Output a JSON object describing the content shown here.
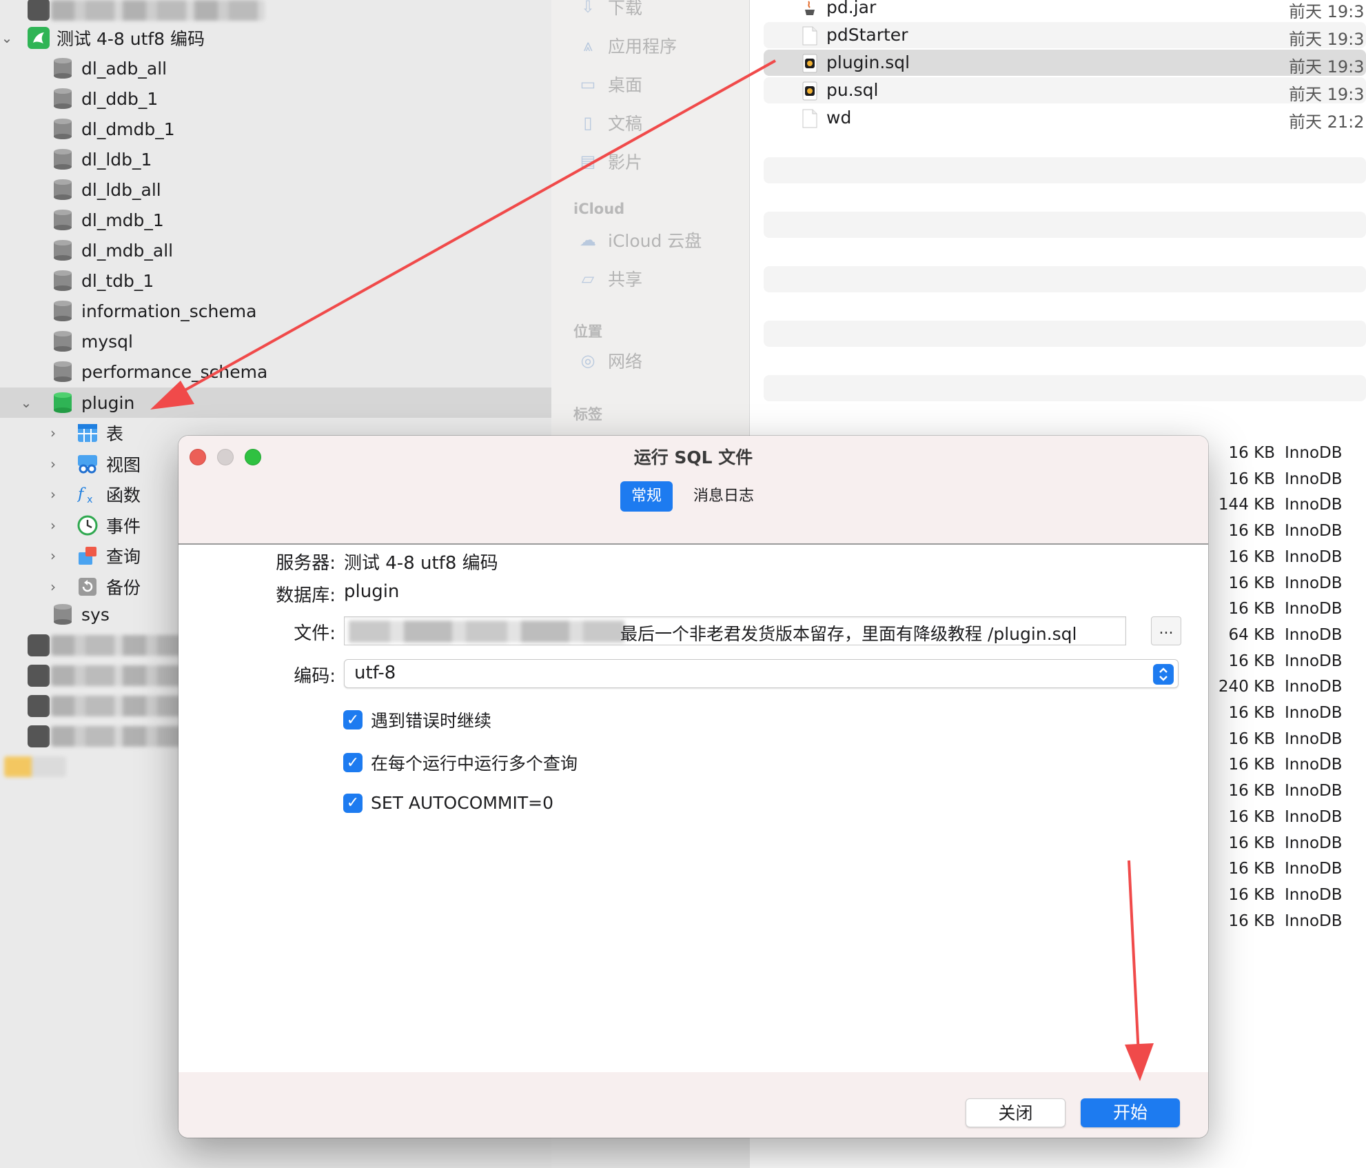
{
  "tree": {
    "top_connection_blurred": "",
    "connection": "测试 4-8 utf8 编码",
    "databases": [
      "dl_adb_all",
      "dl_ddb_1",
      "dl_dmdb_1",
      "dl_ldb_1",
      "dl_ldb_all",
      "dl_mdb_1",
      "dl_mdb_all",
      "dl_tdb_1",
      "information_schema",
      "mysql",
      "performance_schema"
    ],
    "open_database": "plugin",
    "objects": [
      "表",
      "视图",
      "函数",
      "事件",
      "查询",
      "备份"
    ],
    "last_database": "sys"
  },
  "finder_sidebar": {
    "favorites": [
      {
        "label": "下载",
        "icon": "download-icon"
      },
      {
        "label": "应用程序",
        "icon": "applications-icon"
      },
      {
        "label": "桌面",
        "icon": "desktop-icon"
      },
      {
        "label": "文稿",
        "icon": "document-icon"
      },
      {
        "label": "影片",
        "icon": "movies-icon"
      }
    ],
    "icloud_header": "iCloud",
    "icloud": [
      {
        "label": "iCloud 云盘",
        "icon": "cloud-icon"
      },
      {
        "label": "共享",
        "icon": "shared-folder-icon"
      }
    ],
    "locations_header": "位置",
    "locations": [
      {
        "label": "网络",
        "icon": "network-icon"
      }
    ],
    "tags_header": "标签"
  },
  "finder_files": [
    {
      "name": "pd.jar",
      "date": "前天 19:3",
      "icon": "java-jar-icon"
    },
    {
      "name": "pdStarter",
      "date": "前天 19:3",
      "icon": "blank-file-icon"
    },
    {
      "name": "plugin.sql",
      "date": "前天 19:3",
      "icon": "sql-file-icon"
    },
    {
      "name": "pu.sql",
      "date": "前天 19:3",
      "icon": "sql-file-icon"
    },
    {
      "name": "wd",
      "date": "前天 21:2",
      "icon": "blank-file-icon"
    }
  ],
  "table_sizes": [
    {
      "size": "16 KB",
      "engine": "InnoDB"
    },
    {
      "size": "16 KB",
      "engine": "InnoDB"
    },
    {
      "size": "144 KB",
      "engine": "InnoDB"
    },
    {
      "size": "16 KB",
      "engine": "InnoDB"
    },
    {
      "size": "16 KB",
      "engine": "InnoDB"
    },
    {
      "size": "16 KB",
      "engine": "InnoDB"
    },
    {
      "size": "16 KB",
      "engine": "InnoDB"
    },
    {
      "size": "64 KB",
      "engine": "InnoDB"
    },
    {
      "size": "16 KB",
      "engine": "InnoDB"
    },
    {
      "size": "240 KB",
      "engine": "InnoDB"
    },
    {
      "size": "16 KB",
      "engine": "InnoDB"
    },
    {
      "size": "16 KB",
      "engine": "InnoDB"
    },
    {
      "size": "16 KB",
      "engine": "InnoDB"
    },
    {
      "size": "16 KB",
      "engine": "InnoDB"
    },
    {
      "size": "16 KB",
      "engine": "InnoDB"
    },
    {
      "size": "16 KB",
      "engine": "InnoDB"
    },
    {
      "size": "16 KB",
      "engine": "InnoDB"
    },
    {
      "size": "16 KB",
      "engine": "InnoDB"
    },
    {
      "size": "16 KB",
      "engine": "InnoDB"
    }
  ],
  "dialog": {
    "title": "运行 SQL 文件",
    "tabs": [
      "常规",
      "消息日志"
    ],
    "server_label": "服务器:",
    "server_value": "测试 4-8 utf8 编码",
    "database_label": "数据库:",
    "database_value": "plugin",
    "file_label": "文件:",
    "file_value_visible": "最后一个非老君发货版本留存，里面有降级教程 /plugin.sql",
    "browse_label": "...",
    "encoding_label": "编码:",
    "encoding_value": "utf-8",
    "options": [
      "遇到错误时继续",
      "在每个运行中运行多个查询",
      "SET AUTOCOMMIT=0"
    ],
    "close_label": "关闭",
    "start_label": "开始"
  },
  "colors": {
    "accent": "#1d7bf0",
    "annotation_arrow": "#f04a4a",
    "close_light": "#ec5f57",
    "min_light": "#d6d0d0",
    "max_light": "#2fc141",
    "db_selected": "#2fb455"
  }
}
